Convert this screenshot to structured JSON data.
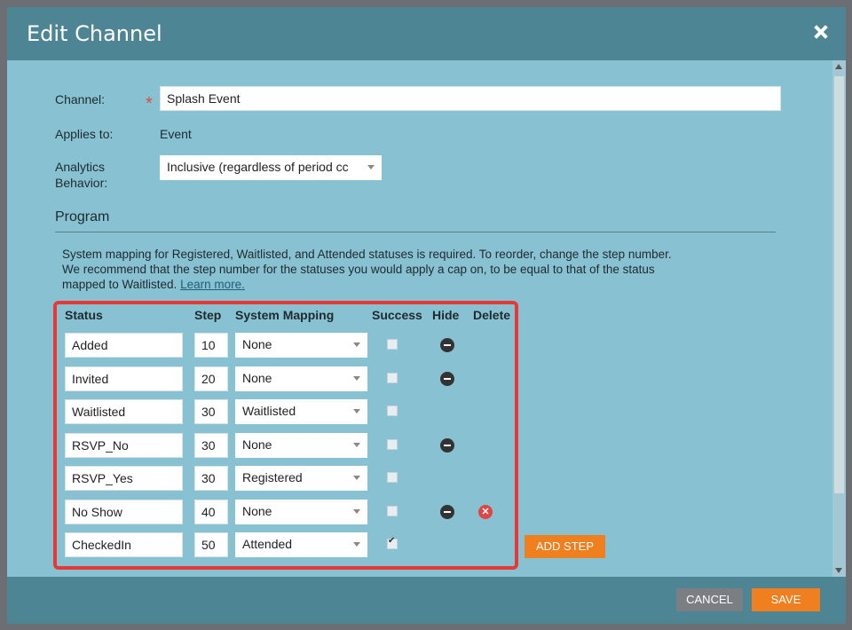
{
  "dialog": {
    "title": "Edit Channel"
  },
  "form": {
    "channel_label": "Channel:",
    "channel_value": "Splash Event",
    "applies_label": "Applies to:",
    "applies_value": "Event",
    "analytics_label_1": "Analytics",
    "analytics_label_2": "Behavior:",
    "analytics_value": "Inclusive (regardless of period cc"
  },
  "program": {
    "heading": "Program",
    "desc_1": "System mapping for Registered, Waitlisted, and Attended statuses is required. To reorder, change the step number.",
    "desc_2": "We recommend that the step number for the statuses you would apply a cap on, to be equal to that of the status",
    "desc_3": "mapped to Waitlisted.",
    "learn_more": "Learn more."
  },
  "table": {
    "headers": {
      "status": "Status",
      "step": "Step",
      "mapping": "System Mapping",
      "success": "Success",
      "hide": "Hide",
      "delete": "Delete"
    },
    "rows": [
      {
        "status": "Added",
        "step": "10",
        "mapping": "None",
        "success": false,
        "hide": true,
        "delete": false
      },
      {
        "status": "Invited",
        "step": "20",
        "mapping": "None",
        "success": false,
        "hide": true,
        "delete": false
      },
      {
        "status": "Waitlisted",
        "step": "30",
        "mapping": "Waitlisted",
        "success": false,
        "hide": false,
        "delete": false
      },
      {
        "status": "RSVP_No",
        "step": "30",
        "mapping": "None",
        "success": false,
        "hide": true,
        "delete": false
      },
      {
        "status": "RSVP_Yes",
        "step": "30",
        "mapping": "Registered",
        "success": false,
        "hide": false,
        "delete": false
      },
      {
        "status": "No Show",
        "step": "40",
        "mapping": "None",
        "success": false,
        "hide": true,
        "delete": true
      },
      {
        "status": "CheckedIn",
        "step": "50",
        "mapping": "Attended",
        "success": true,
        "hide": false,
        "delete": false
      }
    ]
  },
  "buttons": {
    "add_step": "ADD STEP",
    "cancel": "CANCEL",
    "save": "SAVE"
  },
  "colors": {
    "header": "#4e8594",
    "body": "#88c1d1",
    "accent": "#f07f1f",
    "highlight_box": "#e53935"
  }
}
